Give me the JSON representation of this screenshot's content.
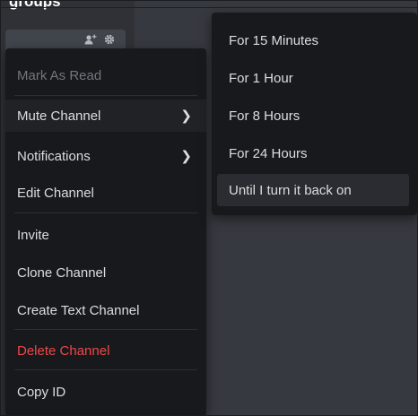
{
  "server": {
    "name": "groups"
  },
  "channel_row": {
    "icons": [
      "add-member-icon",
      "gear-icon"
    ]
  },
  "context_menu": {
    "items": [
      {
        "label": "Mark As Read",
        "state": "disabled"
      },
      {
        "label": "Mute Channel",
        "state": "active",
        "has_submenu": true
      },
      {
        "label": "Notifications",
        "has_submenu": true
      },
      {
        "label": "Edit Channel"
      },
      {
        "label": "Invite"
      },
      {
        "label": "Clone Channel"
      },
      {
        "label": "Create Text Channel"
      },
      {
        "label": "Delete Channel",
        "state": "danger"
      },
      {
        "label": "Copy ID"
      }
    ]
  },
  "mute_submenu": {
    "items": [
      {
        "label": "For 15 Minutes"
      },
      {
        "label": "For 1 Hour"
      },
      {
        "label": "For 8 Hours"
      },
      {
        "label": "For 24 Hours"
      },
      {
        "label": "Until I turn it back on",
        "state": "hover"
      }
    ]
  },
  "colors": {
    "background": "#36393f",
    "menu": "#18191c",
    "danger": "#f04747",
    "text": "#dcddde",
    "disabled": "#72767d"
  }
}
